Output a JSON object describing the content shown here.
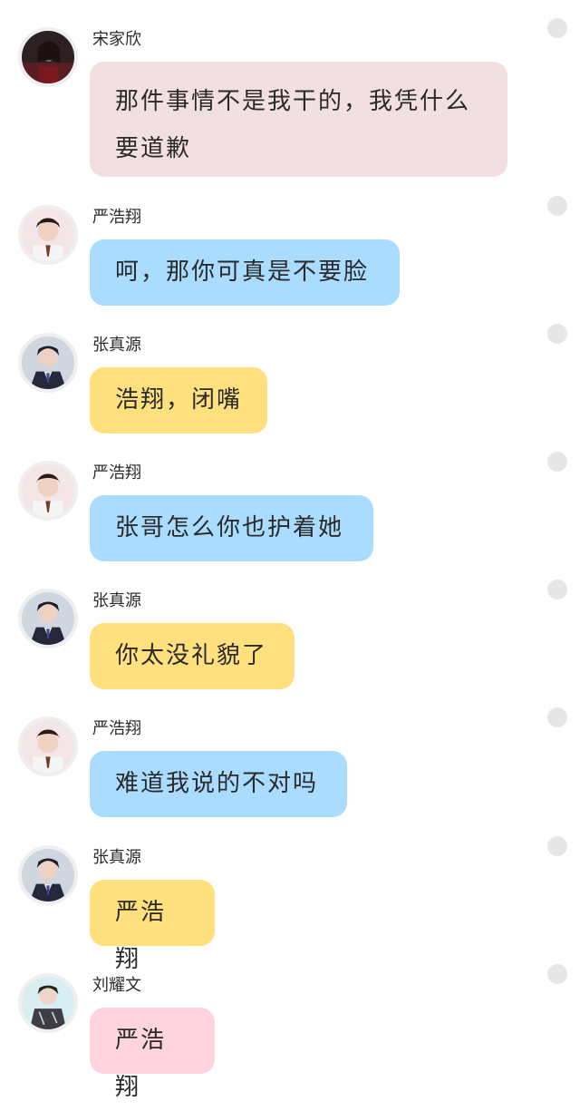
{
  "colors": {
    "pink_bubble": "#f2dfe1",
    "blue_bubble": "#a9dcff",
    "yellow_bubble": "#ffe07e",
    "rose_bubble": "#ffd4df",
    "dot": "#e6e6e6"
  },
  "messages": [
    {
      "sender": "宋家欣",
      "text": "那件事情不是我干的，我凭什么要道歉",
      "avatar": "avatar-woman-dark-red",
      "bubble": "pink"
    },
    {
      "sender": "严浩翔",
      "text": "呵，那你可真是不要脸",
      "avatar": "avatar-young-man-portrait",
      "bubble": "blue"
    },
    {
      "sender": "张真源",
      "text": "浩翔，闭嘴",
      "avatar": "avatar-young-man-suit",
      "bubble": "yellow"
    },
    {
      "sender": "严浩翔",
      "text": "张哥怎么你也护着她",
      "avatar": "avatar-young-man-portrait",
      "bubble": "blue"
    },
    {
      "sender": "张真源",
      "text": "你太没礼貌了",
      "avatar": "avatar-young-man-suit",
      "bubble": "yellow"
    },
    {
      "sender": "严浩翔",
      "text": "难道我说的不对吗",
      "avatar": "avatar-young-man-portrait",
      "bubble": "blue"
    },
    {
      "sender": "张真源",
      "text": "严浩翔",
      "avatar": "avatar-young-man-suit",
      "bubble": "yellow"
    },
    {
      "sender": "刘耀文",
      "text": "严浩翔",
      "avatar": "avatar-young-man-casual",
      "bubble": "rose"
    }
  ]
}
